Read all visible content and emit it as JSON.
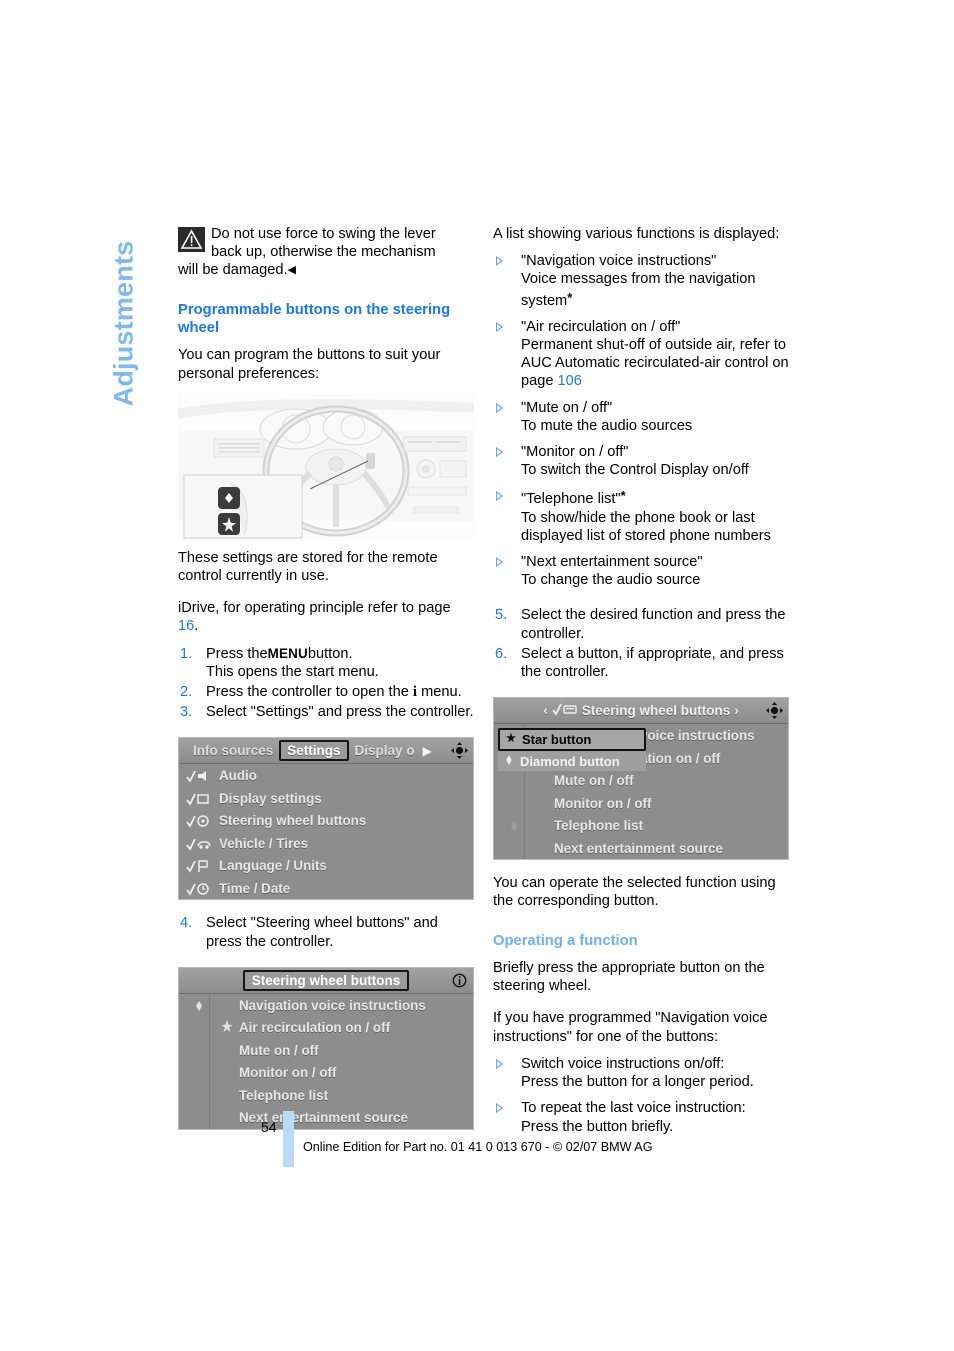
{
  "section_tab": {
    "label": "Adjustments"
  },
  "left_column": {
    "warning": {
      "icon": "warning-triangle-icon",
      "line1": "Do not use force to swing the lever",
      "line2": "back up, otherwise the mechanism",
      "line3": "will be damaged.",
      "end_marker": "◀"
    },
    "heading": "Programmable buttons on the steering wheel",
    "intro": "You can program the buttons to suit your personal preferences:",
    "after_image_text": "These settings are stored for the remote control currently in use.",
    "idrive_note_prefix": "iDrive, for operating principle refer to page ",
    "idrive_note_page": "16",
    "idrive_note_suffix": ".",
    "steps": [
      {
        "num": "1.",
        "pre": "Press the",
        "key": "MENU",
        "post": "button.",
        "sub": "This opens the start menu."
      },
      {
        "num": "2.",
        "pre": "Press the controller to open the",
        "key": "i",
        "post": "menu.",
        "sub": ""
      },
      {
        "num": "3.",
        "pre": "Select \"Settings\" and press the controller.",
        "key": "",
        "post": "",
        "sub": ""
      }
    ],
    "step4": {
      "num": "4.",
      "text": "Select \"Steering wheel buttons\" and press the controller."
    }
  },
  "settings_screenshot": {
    "name": "idrive-settings-menu",
    "tabs": [
      {
        "label": "Info sources",
        "selected": false
      },
      {
        "label": "Settings",
        "selected": true
      },
      {
        "label": "Display o",
        "selected": false
      }
    ],
    "next_arrow": "▶",
    "controller_icon": "joystick-icon",
    "items": [
      {
        "icon": "audio-icon",
        "label": "Audio"
      },
      {
        "icon": "display-settings-icon",
        "label": "Display settings"
      },
      {
        "icon": "steering-wheel-icon",
        "label": "Steering wheel buttons"
      },
      {
        "icon": "vehicle-tires-icon",
        "label": "Vehicle / Tires"
      },
      {
        "icon": "language-units-icon",
        "label": "Language / Units"
      },
      {
        "icon": "time-date-icon",
        "label": "Time / Date"
      }
    ]
  },
  "swbuttons_screenshot": {
    "name": "idrive-steering-wheel-buttons-list",
    "title": "Steering wheel buttons",
    "info_icon": "info-icon",
    "items": [
      {
        "marker": "diamond",
        "label": "Navigation voice instructions"
      },
      {
        "marker": "star",
        "label": "Air recirculation on / off"
      },
      {
        "marker": "",
        "label": "Mute on / off"
      },
      {
        "marker": "",
        "label": "Monitor on / off"
      },
      {
        "marker": "",
        "label": "Telephone list"
      },
      {
        "marker": "",
        "label": "Next entertainment source"
      }
    ]
  },
  "assign_screenshot": {
    "name": "idrive-assign-button-popup",
    "title": "Steering wheel buttons",
    "title_prefix_arrow": "‹",
    "title_suffix_arrow": "›",
    "check_icon": "checked-steering-wheel-icon",
    "controller_icon": "joystick-icon",
    "popup": [
      {
        "glyph": "✦",
        "label": "Star button",
        "selected": true
      },
      {
        "glyph": "♦",
        "label": "Diamond button",
        "selected": false
      }
    ],
    "items": [
      {
        "marker": "",
        "label": "voice instructions"
      },
      {
        "marker": "",
        "label": "ation on / off"
      },
      {
        "marker": "",
        "label": "Mute on / off"
      },
      {
        "marker": "",
        "label": "Monitor on / off"
      },
      {
        "marker": "",
        "label": "Telephone list"
      },
      {
        "marker": "",
        "label": "Next entertainment source"
      }
    ],
    "rail_marker": "diamond"
  },
  "illustration": {
    "name": "steering-wheel-cockpit-illustration",
    "inset_buttons": [
      "diamond-button",
      "star-button"
    ]
  },
  "right_column": {
    "intro": "A list showing various functions is displayed:",
    "functions": [
      {
        "title": "\"Navigation voice instructions\"",
        "desc": "Voice messages from the navigation system",
        "footnote": "*",
        "page": "",
        "desc_tail": ""
      },
      {
        "title": "\"Air recirculation on / off\"",
        "desc": "Permanent shut-off of outside air, refer to AUC Automatic recirculated-air control on page ",
        "footnote": "",
        "page": "106",
        "desc_tail": ""
      },
      {
        "title": "\"Mute on / off\"",
        "desc": "To mute the audio sources",
        "footnote": "",
        "page": "",
        "desc_tail": ""
      },
      {
        "title": "\"Monitor on / off\"",
        "desc": "To switch the Control Display on/off",
        "footnote": "",
        "page": "",
        "desc_tail": ""
      },
      {
        "title": "\"Telephone list\"",
        "desc": "To show/hide the phone book or last displayed list of stored phone numbers",
        "footnote": "*",
        "page": "",
        "desc_tail": ""
      },
      {
        "title": "\"Next entertainment source\"",
        "desc": "To change the audio source",
        "footnote": "",
        "page": "",
        "desc_tail": ""
      }
    ],
    "steps": [
      {
        "num": "5.",
        "text": "Select the desired function and press the controller."
      },
      {
        "num": "6.",
        "text": "Select a button, if appropriate, and press the controller."
      }
    ],
    "after_shot_text": "You can operate the selected function using the corresponding button.",
    "heading2": "Operating a function",
    "para1": "Briefly press the appropriate button on the steering wheel.",
    "para2": "If you have programmed \"Navigation voice instructions\" for one of the buttons:",
    "bullets": [
      {
        "title": "Switch voice instructions on/off:",
        "desc": "Press the button for a longer period."
      },
      {
        "title": "To repeat the last voice instruction:",
        "desc": "Press the button briefly."
      }
    ]
  },
  "footer": {
    "page_number": "54",
    "edition": "Online Edition for Part no. 01 41 0 013 670 - © 02/07 BMW AG"
  },
  "colors": {
    "heading_blue": "#1878ef",
    "light_blue": "#6cb0f5",
    "bullet_blue": "#5aa6f0",
    "footer_bar": "#bcd9f6"
  }
}
